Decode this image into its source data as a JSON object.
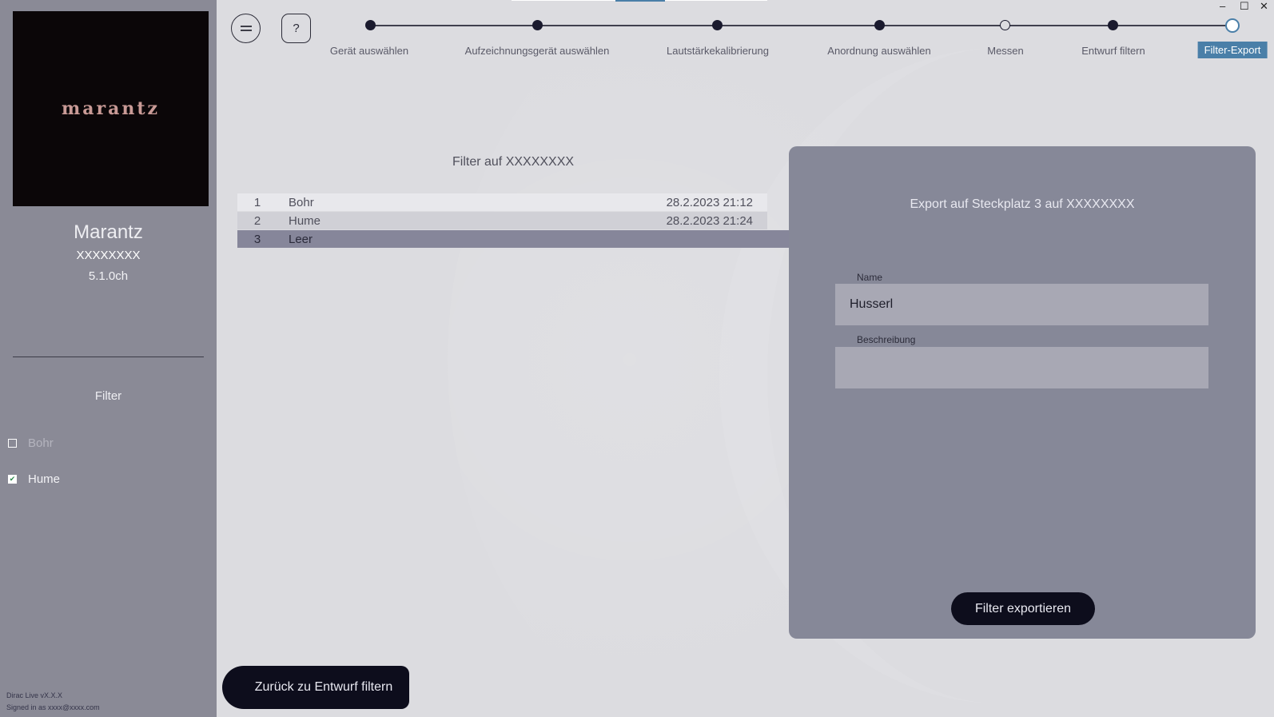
{
  "sidebar": {
    "logo_text": "marantz",
    "device_name": "Marantz",
    "device_serial": "XXXXXXXX",
    "device_channels": "5.1.0ch",
    "filter_heading": "Filter",
    "filters": [
      {
        "label": "Bohr",
        "checked": false
      },
      {
        "label": "Hume",
        "checked": true
      }
    ],
    "footer_version": "Dirac Live vX.X.X",
    "footer_signin": "Signed in as xxxx@xxxx.com"
  },
  "toolbar": {
    "menu_icon": "menu-lines-icon",
    "help_icon": "help-question-icon",
    "help_glyph": "?"
  },
  "stepper": {
    "steps": [
      {
        "label": "Gerät auswählen",
        "state": "done"
      },
      {
        "label": "Aufzeichnungsgerät auswählen",
        "state": "done"
      },
      {
        "label": "Lautstärkekalibrierung",
        "state": "done"
      },
      {
        "label": "Anordnung auswählen",
        "state": "done"
      },
      {
        "label": "Messen",
        "state": "pending"
      },
      {
        "label": "Entwurf filtern",
        "state": "done"
      },
      {
        "label": "Filter-Export",
        "state": "active"
      }
    ]
  },
  "window_controls": {
    "minimize": "–",
    "maximize": "☐",
    "close": "✕"
  },
  "slots": {
    "title": "Filter auf XXXXXXXX",
    "rows": [
      {
        "num": "1",
        "name": "Bohr",
        "date": "28.2.2023 21:12"
      },
      {
        "num": "2",
        "name": "Hume",
        "date": "28.2.2023 21:24"
      },
      {
        "num": "3",
        "name": "Leer",
        "date": ""
      }
    ]
  },
  "export_panel": {
    "title": "Export auf Steckplatz 3 auf XXXXXXXX",
    "name_label": "Name",
    "name_value": "Husserl",
    "description_label": "Beschreibung",
    "description_value": "",
    "export_button": "Filter exportieren"
  },
  "back_button": "Zurück zu Entwurf filtern",
  "colors": {
    "accent": "#4a7fa8",
    "sidebar_bg": "#8a8a96",
    "panel_bg": "#868898",
    "button_bg": "#0d0d1c"
  }
}
